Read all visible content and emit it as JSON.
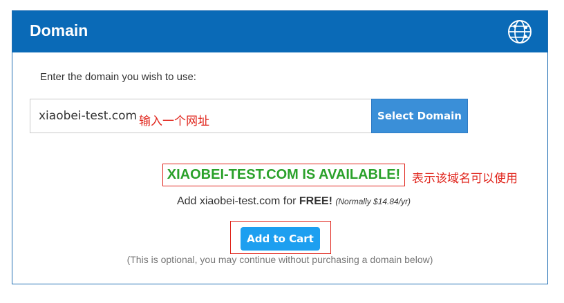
{
  "header": {
    "title": "Domain",
    "icon": "globe-icon"
  },
  "prompt": "Enter the domain you wish to use:",
  "domain_input": {
    "value": "xiaobei-test.com",
    "annotation": "输入一个网址"
  },
  "select_button": "Select Domain",
  "availability": {
    "message": "XIAOBEI-TEST.COM IS AVAILABLE!",
    "annotation": "表示该域名可以使用"
  },
  "offer": {
    "prefix": "Add xiaobei-test.com for ",
    "free": "FREE!",
    "normally": "(Normally $14.84/yr)"
  },
  "cart_button": "Add to Cart",
  "optional_note": "(This is optional, you may continue without purchasing a domain below)",
  "colors": {
    "header_bg": "#0a6ab7",
    "available": "#2aa12a",
    "annotation": "#e0241b",
    "select_button": "#3a8fd8",
    "cart_button": "#1d9ff0"
  }
}
